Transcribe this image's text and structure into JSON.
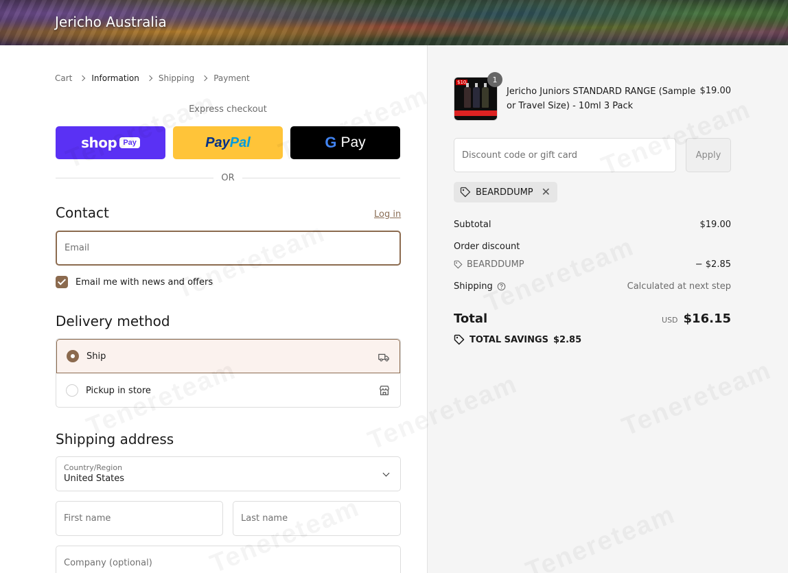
{
  "header": {
    "brand": "Jericho Australia"
  },
  "breadcrumb": {
    "cart": "Cart",
    "information": "Information",
    "shipping": "Shipping",
    "payment": "Payment"
  },
  "express": {
    "label": "Express checkout",
    "shop_word": "shop",
    "shop_pill": "Pay",
    "paypal_1": "Pay",
    "paypal_2": "Pal",
    "gpay_g": "G",
    "gpay_pay": "Pay",
    "or": "OR"
  },
  "contact": {
    "title": "Contact",
    "login": "Log in",
    "email_placeholder": "Email",
    "newsletter": "Email me with news and offers"
  },
  "delivery": {
    "title": "Delivery method",
    "ship": "Ship",
    "pickup": "Pickup in store"
  },
  "shipping_address": {
    "title": "Shipping address",
    "country_label": "Country/Region",
    "country_value": "United States",
    "first_name": "First name",
    "last_name": "Last name",
    "company": "Company (optional)"
  },
  "summary": {
    "item": {
      "quantity": "1",
      "name": "Jericho Juniors STANDARD RANGE (Sample or Travel Size) - 10ml 3 Pack",
      "price": "$19.00"
    },
    "discount_placeholder": "Discount code or gift card",
    "apply": "Apply",
    "applied_code": "BEARDDUMP",
    "subtotal_label": "Subtotal",
    "subtotal_value": "$19.00",
    "order_discount_label": "Order discount",
    "discount_code": "BEARDDUMP",
    "discount_value": "− $2.85",
    "shipping_label": "Shipping",
    "shipping_value": "Calculated at next step",
    "total_label": "Total",
    "currency": "USD",
    "total_value": "$16.15",
    "savings_label": "TOTAL SAVINGS",
    "savings_value": "$2.85"
  },
  "colors": {
    "accent": "#8b6a4e",
    "shop_pay": "#5a31f4",
    "paypal": "#ffc439",
    "gpay": "#000000"
  }
}
